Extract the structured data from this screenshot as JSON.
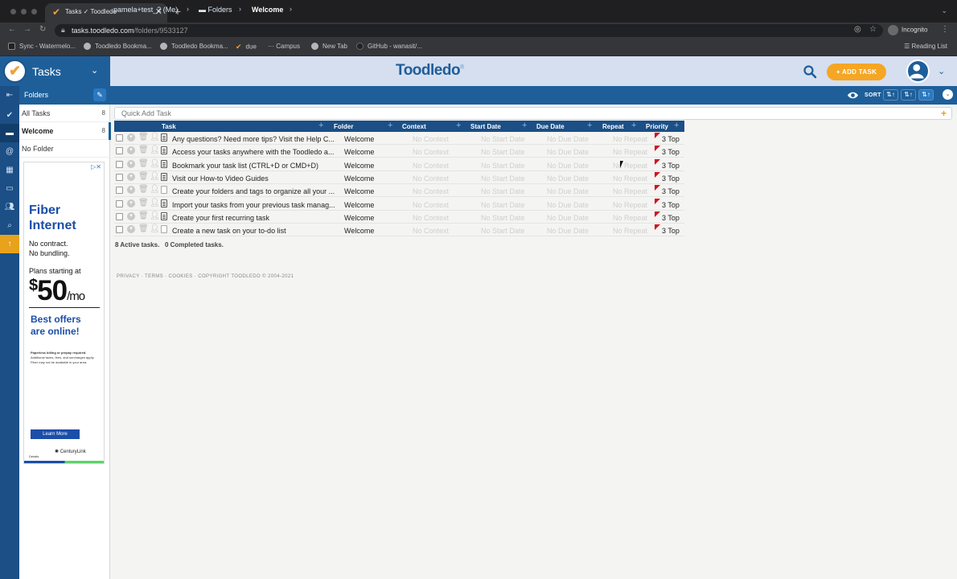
{
  "browser": {
    "tab_title": "Tasks ✓ Toodledo",
    "url_domain": "tasks.toodledo.com",
    "url_path": "/folders/9533127",
    "incognito_label": "Incognito",
    "bookmarks": [
      "Sync - Watermelo...",
      "Toodledo Bookma...",
      "Toodledo Bookma...",
      "due",
      "Campus",
      "New Tab",
      "GitHub - wanasit/..."
    ],
    "reading_list": "Reading List"
  },
  "app": {
    "section_title": "Tasks",
    "logo_text": "Toodledo",
    "add_task_label": "+ ADD TASK"
  },
  "sidebar": {
    "header": "Folders",
    "folders": [
      {
        "name": "All Tasks",
        "count": "8"
      },
      {
        "name": "Welcome",
        "count": "8"
      },
      {
        "name": "No Folder",
        "count": ""
      }
    ]
  },
  "breadcrumb": {
    "user": "pamela+test_2 (Me)",
    "folders": "Folders",
    "current": "Welcome"
  },
  "toolbar": {
    "sort_label": "SORT"
  },
  "quick_add": {
    "placeholder": "Quick Add Task"
  },
  "columns": [
    "Task",
    "Folder",
    "Context",
    "Start Date",
    "Due Date",
    "Repeat",
    "Priority"
  ],
  "tasks": [
    {
      "name": "Any questions? Need more tips? Visit the Help C...",
      "folder": "Welcome",
      "context": "No Context",
      "start": "No Start Date",
      "due": "No Due Date",
      "repeat": "No Repeat",
      "priority": "3 Top",
      "has_note": true
    },
    {
      "name": "Access your tasks anywhere with the Toodledo a...",
      "folder": "Welcome",
      "context": "No Context",
      "start": "No Start Date",
      "due": "No Due Date",
      "repeat": "No Repeat",
      "priority": "3 Top",
      "has_note": true
    },
    {
      "name": "Bookmark your task list (CTRL+D or CMD+D)",
      "folder": "Welcome",
      "context": "No Context",
      "start": "No Start Date",
      "due": "No Due Date",
      "repeat": "No Repeat",
      "priority": "3 Top",
      "has_note": true
    },
    {
      "name": "Visit our How-to Video Guides",
      "folder": "Welcome",
      "context": "No Context",
      "start": "No Start Date",
      "due": "No Due Date",
      "repeat": "No Repeat",
      "priority": "3 Top",
      "has_note": true
    },
    {
      "name": "Create your folders and tags to organize all your ...",
      "folder": "Welcome",
      "context": "No Context",
      "start": "No Start Date",
      "due": "No Due Date",
      "repeat": "No Repeat",
      "priority": "3 Top",
      "has_note": false
    },
    {
      "name": "Import your tasks from your previous task manag...",
      "folder": "Welcome",
      "context": "No Context",
      "start": "No Start Date",
      "due": "No Due Date",
      "repeat": "No Repeat",
      "priority": "3 Top",
      "has_note": true
    },
    {
      "name": "Create your first recurring task",
      "folder": "Welcome",
      "context": "No Context",
      "start": "No Start Date",
      "due": "No Due Date",
      "repeat": "No Repeat",
      "priority": "3 Top",
      "has_note": true
    },
    {
      "name": "Create a new task on your to-do list",
      "folder": "Welcome",
      "context": "No Context",
      "start": "No Start Date",
      "due": "No Due Date",
      "repeat": "No Repeat",
      "priority": "3 Top",
      "has_note": false
    }
  ],
  "summary": {
    "active": "8 Active tasks.",
    "completed": "0 Completed tasks."
  },
  "footer": {
    "text": "PRIVACY  ·  TERMS  ·  COOKIES  ·  COPYRIGHT TOODLEDO © 2004-2021"
  },
  "ad": {
    "headline": "Fiber Internet",
    "line1": "No contract.",
    "line2": "No bundling.",
    "plans": "Plans starting at",
    "price": "50",
    "per": "/mo",
    "offer": "Best offers are online!",
    "fine_bold": "Paperless billing or prepay required.",
    "fine": "Additional taxes, fees, and surcharges apply. Fiber may not be available in your area.",
    "cta": "Learn More",
    "brand": "CenturyLink",
    "details": "Details"
  },
  "colors": {
    "brand_blue": "#1e5f9a",
    "header_light": "#d5dff0",
    "accent_orange": "#f5a623",
    "priority_flag": "#d0121f"
  }
}
